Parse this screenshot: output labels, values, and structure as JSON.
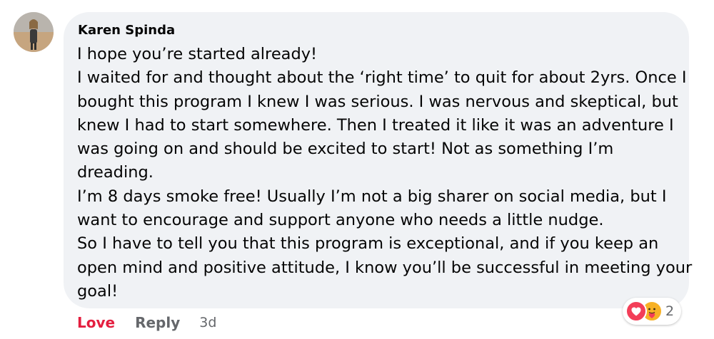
{
  "comment": {
    "author": "Karen Spinda",
    "body_lines": [
      "I hope you’re started already!",
      "I waited for and thought about the ‘right time’ to quit for about 2yrs. Once I",
      "bought this program I knew I was serious. I was nervous and skeptical, but",
      "knew I had to start somewhere. Then I treated it like it was an adventure I",
      "was going on and should be excited to start! Not as something I’m",
      "dreading.",
      "I’m 8 days smoke free! Usually I’m not a big sharer on social media, but I",
      "want to encourage and support anyone who needs a little nudge.",
      "So I have to tell you that this program is exceptional, and if you keep an",
      "open mind and positive attitude, I know you’ll be successful in meeting your",
      "goal!"
    ],
    "actions": {
      "love_label": "Love",
      "reply_label": "Reply",
      "timestamp": "3d"
    },
    "reactions": {
      "icons": [
        "love-icon",
        "care-icon"
      ],
      "count": "2"
    }
  },
  "colors": {
    "bubble_bg": "#f0f2f5",
    "love_red": "#e41e3f",
    "secondary_text": "#65676b",
    "primary_text": "#050505"
  }
}
